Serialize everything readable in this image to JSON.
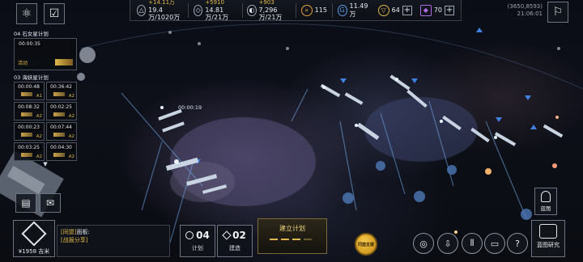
{
  "topbar": {
    "resources": [
      {
        "icon": "metal-icon",
        "top": "+14.11万",
        "bottom": "19.4万/1020万"
      },
      {
        "icon": "crystal-icon",
        "top": "+5910",
        "bottom": "14.81万/21万"
      },
      {
        "icon": "deuterium-icon",
        "top": "+903",
        "bottom": "7,296万/21万"
      }
    ],
    "fuel": "115",
    "credits": "11.49万",
    "gold": "64",
    "premium": "70"
  },
  "coords": {
    "position": "(3650,8593)",
    "time": "21:06:01"
  },
  "plans": {
    "venus": {
      "title": "04 石女星计划",
      "timer": "00:00:35",
      "status": "活动"
    },
    "sea": {
      "title": "03 海妖星计划",
      "slots": [
        {
          "timer": "00:00:48",
          "level": "A1"
        },
        {
          "timer": "00:36:42",
          "level": "A2"
        },
        {
          "timer": "00:08:32",
          "level": "A2"
        },
        {
          "timer": "00:02:25",
          "level": "A2"
        },
        {
          "timer": "00:00:23",
          "level": "A2"
        },
        {
          "timer": "00:07:44",
          "level": "A2"
        },
        {
          "timer": "00:03:25",
          "level": "A2"
        },
        {
          "timer": "00:04:30",
          "level": "A2"
        }
      ]
    }
  },
  "fleet_tag": "00:00:19",
  "player": {
    "distance": "¥1958 吉米"
  },
  "chat": {
    "channel": "[同盟]",
    "message": "面板:",
    "share": "[战报分享]"
  },
  "counters": {
    "plan": {
      "value": "04",
      "label": "计划"
    },
    "build": {
      "value": "02",
      "label": "建造"
    }
  },
  "build_plan": {
    "title": "建立计划"
  },
  "gold_button": {
    "label": "同盟支援"
  },
  "blueprint": {
    "label": "蓝图"
  },
  "blueprint_research": {
    "label": "蓝图研究"
  }
}
